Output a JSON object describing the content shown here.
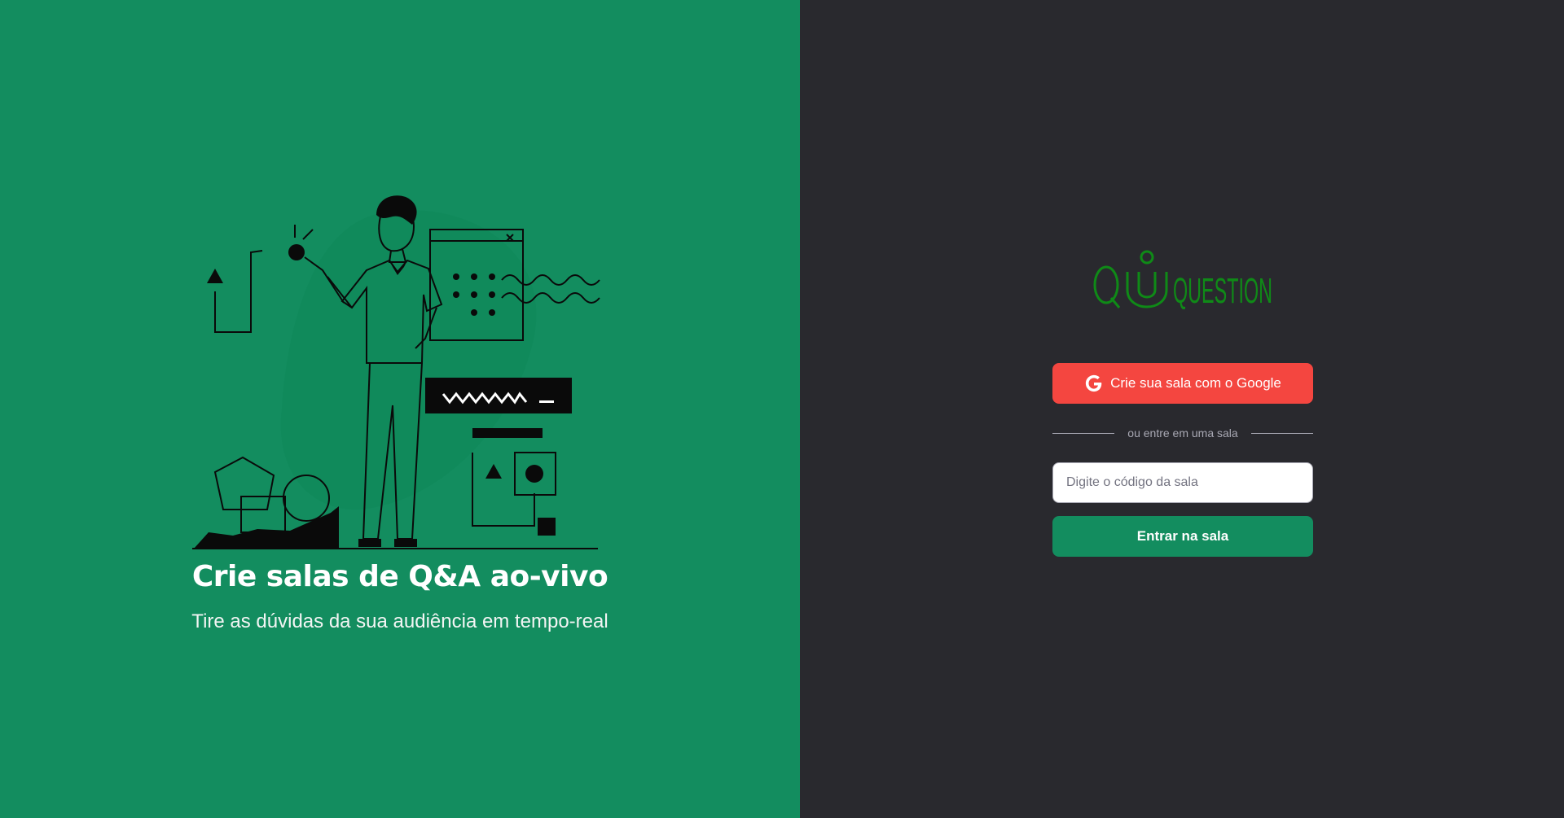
{
  "colors": {
    "left_bg": "#138d5f",
    "right_bg": "#29292e",
    "google_button": "#f44640",
    "enter_button": "#138d5f",
    "logo": "#0f8a17"
  },
  "left": {
    "title": "Crie salas de Q&A ao-vivo",
    "subtitle": "Tire as dúvidas da sua audiência em tempo-real",
    "illustration": "person-presenting-illustration"
  },
  "right": {
    "logo_text": "QUESTION",
    "google_button_label": "Crie sua sala com o Google",
    "google_icon": "google-g-icon",
    "separator_text": "ou entre em uma sala",
    "room_input": {
      "placeholder": "Digite o código da sala",
      "value": ""
    },
    "enter_button_label": "Entrar na sala"
  }
}
